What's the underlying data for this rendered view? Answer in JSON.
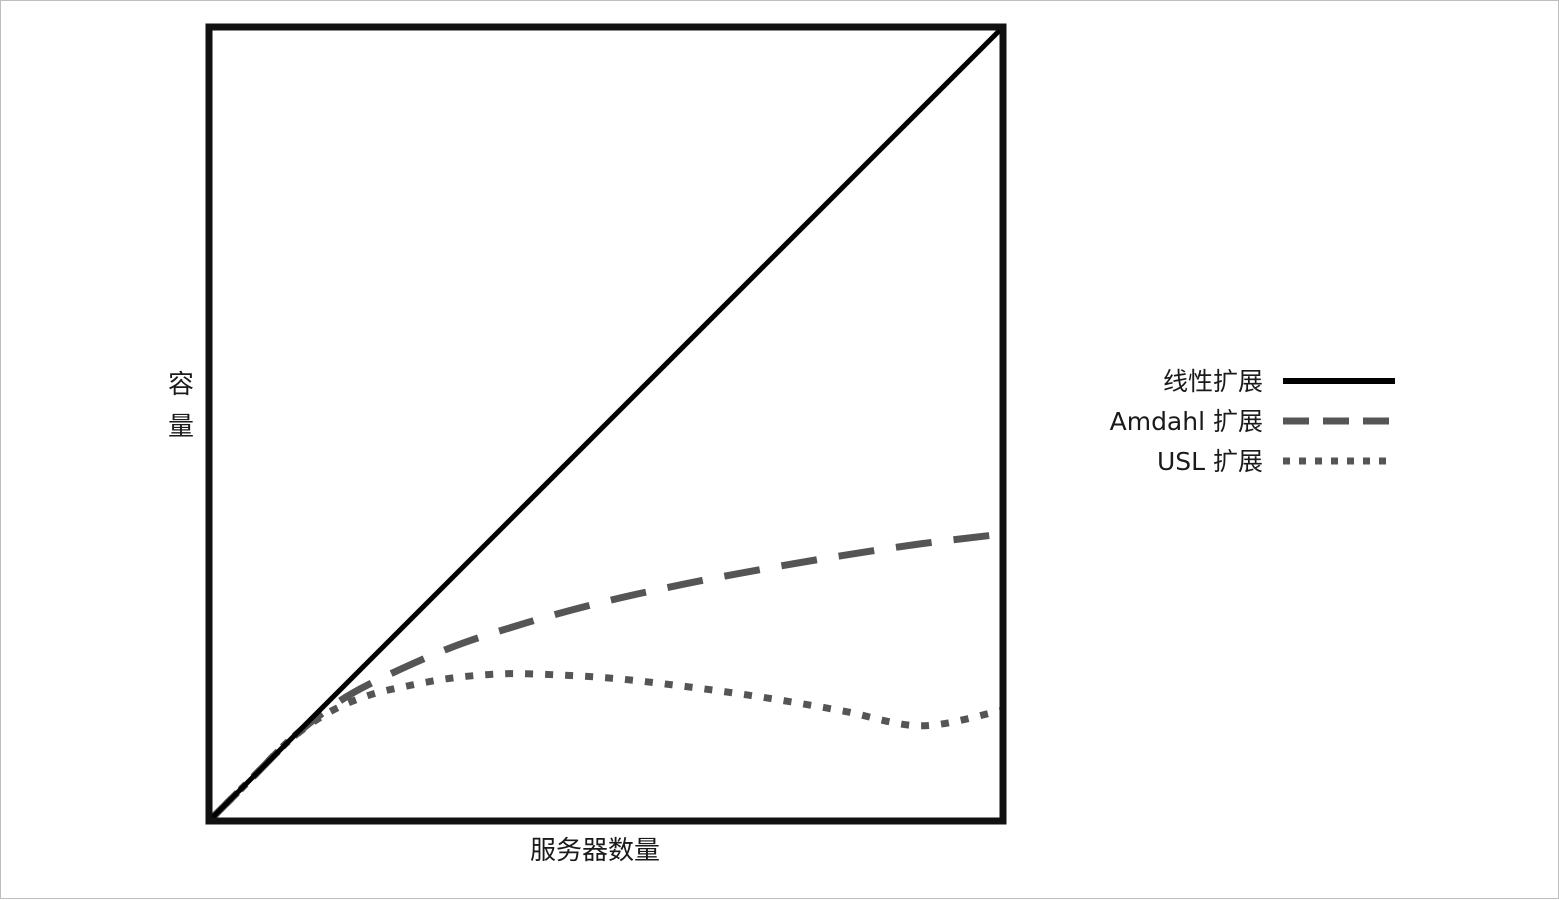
{
  "chart_data": {
    "type": "line",
    "title": "",
    "xlabel": "服务器数量",
    "ylabel": "容量",
    "xlim": [
      0,
      100
    ],
    "ylim": [
      0,
      100
    ],
    "grid": false,
    "legend_position": "right",
    "series": [
      {
        "name": "线性扩展",
        "style": "solid",
        "color": "#000000",
        "x": [
          0,
          10,
          20,
          30,
          40,
          50,
          60,
          70,
          80,
          90,
          100
        ],
        "y": [
          0,
          10,
          20,
          30,
          40,
          50,
          60,
          70,
          80,
          90,
          100
        ]
      },
      {
        "name": "Amdahl 扩展",
        "style": "dashed",
        "color": "#555555",
        "x": [
          0,
          5,
          10,
          15,
          20,
          30,
          40,
          50,
          60,
          70,
          80,
          90,
          100
        ],
        "y": [
          0,
          5,
          10,
          14,
          17,
          21.5,
          24.8,
          27.5,
          29.7,
          31.6,
          33.3,
          34.8,
          36
        ]
      },
      {
        "name": "USL 扩展",
        "style": "dotted",
        "color": "#555555",
        "x": [
          0,
          5,
          10,
          15,
          20,
          25,
          30,
          35,
          40,
          50,
          60,
          70,
          80,
          90,
          100
        ],
        "y": [
          0,
          5,
          10,
          13.5,
          15.6,
          16.8,
          17.7,
          18.2,
          18.3,
          17.8,
          16.7,
          15.3,
          13.6,
          11.7,
          13.6
        ]
      }
    ]
  }
}
